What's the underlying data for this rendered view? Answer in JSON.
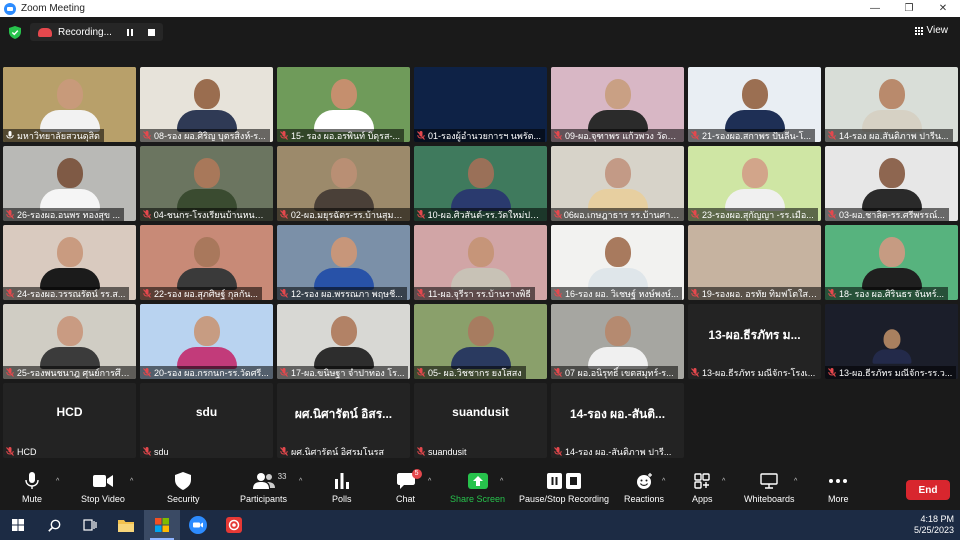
{
  "window": {
    "title": "Zoom Meeting"
  },
  "recording": {
    "label": "Recording..."
  },
  "view": {
    "label": "View"
  },
  "tiles": [
    {
      "name": "มหาวิทยาลัยสวนดุสิต",
      "video": true,
      "bg": "#b8a06a",
      "skin": "#c89a7a",
      "shirt": "#f2f2f2",
      "active": true,
      "mic_on": true
    },
    {
      "name": "08-รอง ผอ.ศิริญ บุตรสิงห์-ร...",
      "video": true,
      "bg": "#e7e3da",
      "skin": "#9a6d4f",
      "shirt": "#2f3a55"
    },
    {
      "name": "15- รอง ผอ.อรพินท์ บิดุรส-...",
      "video": true,
      "bg": "#6f9b5a",
      "skin": "#c58f6e",
      "shirt": "#ffffff"
    },
    {
      "name": "01-รองผู้อำนวยการฯ นพรัต...",
      "video": true,
      "bg": "#0e2246",
      "skin": "#0e2246",
      "shirt": "#1b3a6a",
      "hidePerson": true
    },
    {
      "name": "09-ผอ.จุฑาพร แก้วพวง วัดส...",
      "video": true,
      "bg": "#d8b7c5",
      "skin": "#c9a084",
      "shirt": "#2b2b2b"
    },
    {
      "name": "21-รองผอ.สกาพร ปันลีน-โ...",
      "video": true,
      "bg": "#e9eef3",
      "skin": "#9b6f52",
      "shirt": "#1e2f55"
    },
    {
      "name": "14-รอง ผอ.สันติภาพ ปารีน...",
      "video": true,
      "bg": "#d9ded8",
      "skin": "#b98a6c",
      "shirt": "#d6d1c4"
    },
    {
      "name": "26-รองผอ.อนพร ทองสุข ...",
      "video": true,
      "bg": "#b9b9b6",
      "skin": "#7f5a45",
      "shirt": "#f5f5f5"
    },
    {
      "name": "04-ชนกร-โรงเรียนบ้านหนอง...",
      "video": true,
      "bg": "#6b7560",
      "skin": "#a8785a",
      "shirt": "#3a4b30"
    },
    {
      "name": "02-ผอ.มยุรฉัตร-รร.บ้านสุมพ...",
      "video": true,
      "bg": "#9c8a6b",
      "skin": "#b98f74",
      "shirt": "#4a4038"
    },
    {
      "name": "10-ผอ.ศิวสันต์-รร.วัดใหม่ปาร...",
      "video": true,
      "bg": "#3f7a5d",
      "skin": "#9a7058",
      "shirt": "#2a3a6e"
    },
    {
      "name": "06ผอ.เกษฎาธาร รร.บ้านศาลาลู...",
      "video": true,
      "bg": "#d7d3c9",
      "skin": "#c39a86",
      "shirt": "#e7cfa0"
    },
    {
      "name": "23-รองผอ.สุกัญญา -รร.เมือ...",
      "video": true,
      "bg": "#cfe6a4",
      "skin": "#d2a58a",
      "shirt": "#f0f0f0"
    },
    {
      "name": "03-ผอ.ชาลิต-รร.ศรีพรรณ์...",
      "video": true,
      "bg": "#e7e7e7",
      "skin": "#8e6650",
      "shirt": "#2a2a2a"
    },
    {
      "name": "24-รองผอ.วรรณรัตน์ รร.ส...",
      "video": true,
      "bg": "#d9cabf",
      "skin": "#c99b80",
      "shirt": "#1b1b1b"
    },
    {
      "name": "22-รอง ผอ.สุภศิษฐ์ กุลกัน...",
      "video": true,
      "bg": "#c88a77",
      "skin": "#a9785c",
      "shirt": "#3a3a3a"
    },
    {
      "name": "12-รอง ผอ.พรรณภา พฤษชี...",
      "video": true,
      "bg": "#7b90a8",
      "skin": "#c7967a",
      "shirt": "#2852a8"
    },
    {
      "name": "11-ผอ.จุรีรา รร.บ้านรางพิธี",
      "video": true,
      "bg": "#d1a5a6",
      "skin": "#c69579",
      "shirt": "#c8c2b6"
    },
    {
      "name": "16-รอง ผอ. วิเชษฐ์ หงษ์พงษ์...",
      "video": true,
      "bg": "#f2f2f0",
      "skin": "#a87a5e",
      "shirt": "#dfe6ea"
    },
    {
      "name": "19-รองผอ. อรทัย ทิมฟโตใส ...",
      "video": true,
      "bg": "#c6b3a0",
      "skin": "#c6b3a0",
      "shirt": "#b5a28e",
      "hidePerson": true
    },
    {
      "name": "18- รอง ผอ.ศิรินธร จันทร์...",
      "video": true,
      "bg": "#57b37e",
      "skin": "#c69b82",
      "shirt": "#1f1f1f"
    },
    {
      "name": "25-รองพนชนาฎ ศุนย์การศึก...",
      "video": true,
      "bg": "#d0cdc4",
      "skin": "#c99b82",
      "shirt": "#3b3b3b"
    },
    {
      "name": "20-รอง ผอ.กรกนก-รร.วัดศรี...",
      "video": true,
      "bg": "#b9d3f0",
      "skin": "#c79c82",
      "shirt": "#c23b7a"
    },
    {
      "name": "17-ผอ.ขนิษฐา จำปาทอง โร...",
      "video": true,
      "bg": "#d8d8d4",
      "skin": "#b28266",
      "shirt": "#2d2d2d"
    },
    {
      "name": "05- ผอ.วิชชากร ยงโสสง",
      "video": true,
      "bg": "#8aa06b",
      "skin": "#a77c60",
      "shirt": "#2a3a60"
    },
    {
      "name": "07 ผอ.อนิรุทธิ์ เขตสมุทร์-ร...",
      "video": true,
      "bg": "#a6a6a1",
      "skin": "#b58a70",
      "shirt": "#f0f0f0"
    },
    {
      "name": "13-ผอ.ธีรภัทร มณีจักร-โรงเ...",
      "video": false,
      "big": "13-ผอ.ธีรภัทร ม..."
    },
    {
      "name": "13-ผอ.ธีรภัทร มณีจักร-รร.ว...",
      "video": true,
      "bg": "#1b1e2a",
      "skin": "#a9805f",
      "shirt": "#232a4a",
      "small": true
    },
    {
      "name": "HCD",
      "video": false,
      "big": "HCD"
    },
    {
      "name": "sdu",
      "video": false,
      "big": "sdu"
    },
    {
      "name": "ผศ.นิศารัตน์ อิศรมโนรส",
      "video": false,
      "big": "ผศ.นิศารัตน์ อิสร..."
    },
    {
      "name": "suandusit",
      "video": false,
      "big": "suandusit"
    },
    {
      "name": "14-รอง ผอ.-สันติภาพ ปารี...",
      "video": false,
      "big": "14-รอง ผอ.-สันติ..."
    }
  ],
  "toolbar": {
    "mute": "Mute",
    "stop_video": "Stop Video",
    "security": "Security",
    "participants": "Participants",
    "participants_count": "33",
    "polls": "Polls",
    "chat": "Chat",
    "chat_badge": "5",
    "share_screen": "Share Screen",
    "pause_stop_recording": "Pause/Stop Recording",
    "reactions": "Reactions",
    "apps": "Apps",
    "whiteboards": "Whiteboards",
    "more": "More",
    "end": "End"
  },
  "colors": {
    "share_green": "#27c24c",
    "end_red": "#d8262e",
    "active_speaker": "#c9e265"
  },
  "taskbar": {
    "time": "4:18 PM",
    "date": "5/25/2023"
  }
}
